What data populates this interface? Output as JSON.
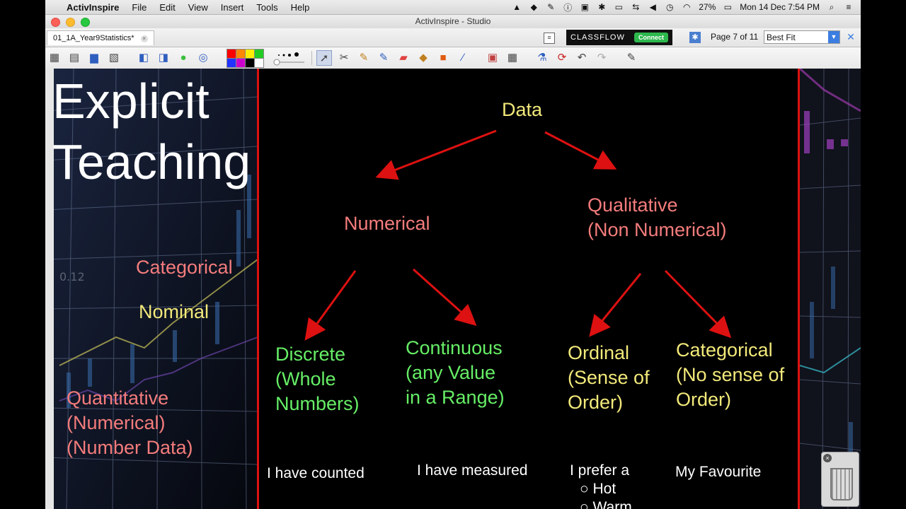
{
  "menubar": {
    "app_name": "ActivInspire",
    "menus": [
      "File",
      "Edit",
      "View",
      "Insert",
      "Tools",
      "Help"
    ],
    "battery": "27%",
    "datetime": "Mon 14 Dec  7:54 PM"
  },
  "window": {
    "title": "ActivInspire - Studio",
    "doc_tab": "01_1A_Year9Statistics*"
  },
  "tabrow": {
    "classflow_label": "CLASSFLOW",
    "connect_label": "Connect",
    "page_info": "Page 7 of 11",
    "zoom_value": "Best Fit"
  },
  "toolbar": {
    "palette_colors": [
      "#ff0000",
      "#ff8800",
      "#ffee00",
      "#22cc22",
      "#2233ff",
      "#cc00cc",
      "#000000",
      "#ffffff"
    ]
  },
  "slide": {
    "heading_line1": "Explicit",
    "heading_line2": "Teaching",
    "left_categorical": "Categorical",
    "left_nominal": "Nominal",
    "left_quant_1": "Quantitative",
    "left_quant_2": "(Numerical)",
    "left_quant_3": "(Number Data)",
    "root": "Data",
    "numerical": "Numerical",
    "qualitative_1": "Qualitative",
    "qualitative_2": "(Non Numerical)",
    "discrete_1": "Discrete",
    "discrete_2": "(Whole",
    "discrete_3": "Numbers)",
    "continuous_1": "Continuous",
    "continuous_2": "(any Value",
    "continuous_3": "in a Range)",
    "ordinal_1": "Ordinal",
    "ordinal_2": "(Sense of",
    "ordinal_3": "Order)",
    "categorical_1": "Categorical",
    "categorical_2": "(No sense of",
    "categorical_3": "Order)",
    "ex_counted": "I have counted",
    "ex_measured": "I have measured",
    "ex_prefer": "I prefer a",
    "ex_hot": "○ Hot",
    "ex_warm": "○ Warm",
    "ex_favourite": "My Favourite",
    "colors": {
      "salmon": "#f47c7c",
      "yellow": "#f2e97a",
      "green": "#66ee66",
      "arrow": "#dd1111"
    }
  }
}
